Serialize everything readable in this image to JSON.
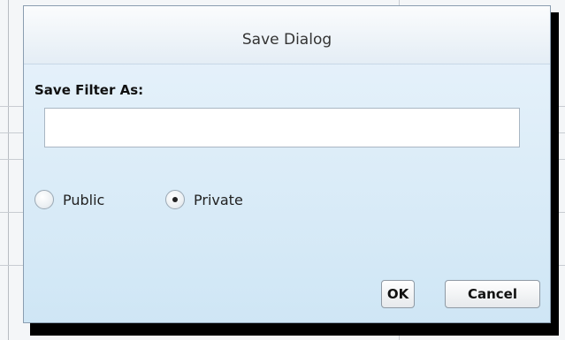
{
  "dialog": {
    "title": "Save Dialog",
    "field_label": "Save Filter As:",
    "name_value": "",
    "visibility": {
      "options": [
        {
          "label": "Public",
          "selected": false
        },
        {
          "label": "Private",
          "selected": true
        }
      ]
    },
    "buttons": {
      "ok_label": "OK",
      "cancel_label": "Cancel"
    }
  }
}
